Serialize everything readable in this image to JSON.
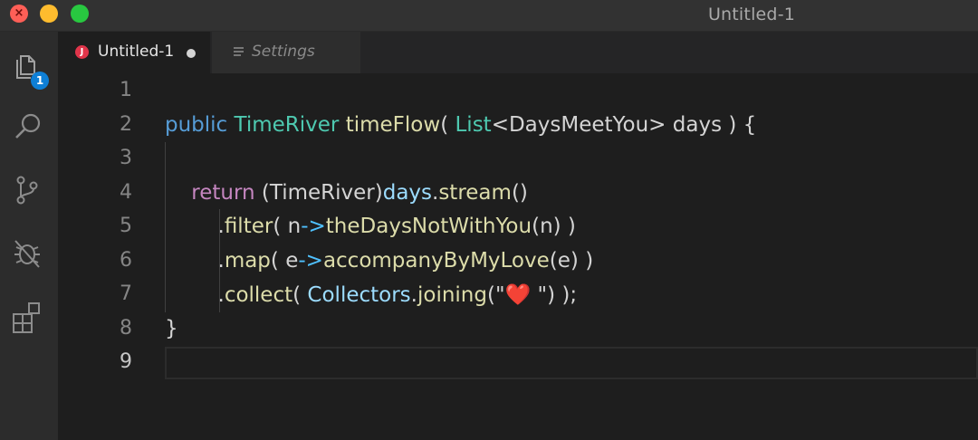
{
  "window": {
    "title": "Untitled-1"
  },
  "activity_bar": {
    "items": [
      {
        "icon": "explorer-icon",
        "badge": "1"
      },
      {
        "icon": "search-icon"
      },
      {
        "icon": "source-control-icon"
      },
      {
        "icon": "debug-icon"
      },
      {
        "icon": "extensions-icon"
      }
    ]
  },
  "tabs": [
    {
      "label": "Untitled-1",
      "icon": "J",
      "dirty": true,
      "active": true
    },
    {
      "label": "Settings",
      "icon": "settings-lines-icon",
      "active": false
    }
  ],
  "editor": {
    "current_line": 9,
    "lines": [
      {
        "n": "1",
        "tokens": []
      },
      {
        "n": "2",
        "tokens": [
          {
            "t": "public",
            "c": "kw"
          },
          {
            "t": " ",
            "c": "plain"
          },
          {
            "t": "TimeRiver",
            "c": "type"
          },
          {
            "t": " ",
            "c": "plain"
          },
          {
            "t": "timeFlow",
            "c": "fn"
          },
          {
            "t": "( ",
            "c": "plain"
          },
          {
            "t": "List",
            "c": "type"
          },
          {
            "t": "<DaysMeetYou> days ) {",
            "c": "plain"
          }
        ]
      },
      {
        "n": "3",
        "tokens": []
      },
      {
        "n": "4",
        "tokens": [
          {
            "t": "    ",
            "c": "plain"
          },
          {
            "t": "return",
            "c": "kw2"
          },
          {
            "t": " (TimeRiver)",
            "c": "plain"
          },
          {
            "t": "days",
            "c": "var"
          },
          {
            "t": ".",
            "c": "plain"
          },
          {
            "t": "stream",
            "c": "fn"
          },
          {
            "t": "()",
            "c": "plain"
          }
        ]
      },
      {
        "n": "5",
        "tokens": [
          {
            "t": "        .",
            "c": "plain"
          },
          {
            "t": "filter",
            "c": "fn"
          },
          {
            "t": "( n",
            "c": "plain"
          },
          {
            "t": "->",
            "c": "op"
          },
          {
            "t": "theDaysNotWithYou",
            "c": "fn"
          },
          {
            "t": "(n) )",
            "c": "plain"
          }
        ]
      },
      {
        "n": "6",
        "tokens": [
          {
            "t": "        .",
            "c": "plain"
          },
          {
            "t": "map",
            "c": "fn"
          },
          {
            "t": "( e",
            "c": "plain"
          },
          {
            "t": "->",
            "c": "op"
          },
          {
            "t": "accompanyByMyLove",
            "c": "fn"
          },
          {
            "t": "(e) )",
            "c": "plain"
          }
        ]
      },
      {
        "n": "7",
        "tokens": [
          {
            "t": "        .",
            "c": "plain"
          },
          {
            "t": "collect",
            "c": "fn"
          },
          {
            "t": "( ",
            "c": "plain"
          },
          {
            "t": "Collectors",
            "c": "var"
          },
          {
            "t": ".",
            "c": "plain"
          },
          {
            "t": "joining",
            "c": "fn"
          },
          {
            "t": "(\"",
            "c": "plain"
          },
          {
            "t": "❤️",
            "c": "str"
          },
          {
            "t": " \") );",
            "c": "plain"
          }
        ]
      },
      {
        "n": "8",
        "tokens": [
          {
            "t": "}",
            "c": "plain"
          }
        ]
      },
      {
        "n": "9",
        "tokens": []
      }
    ]
  }
}
